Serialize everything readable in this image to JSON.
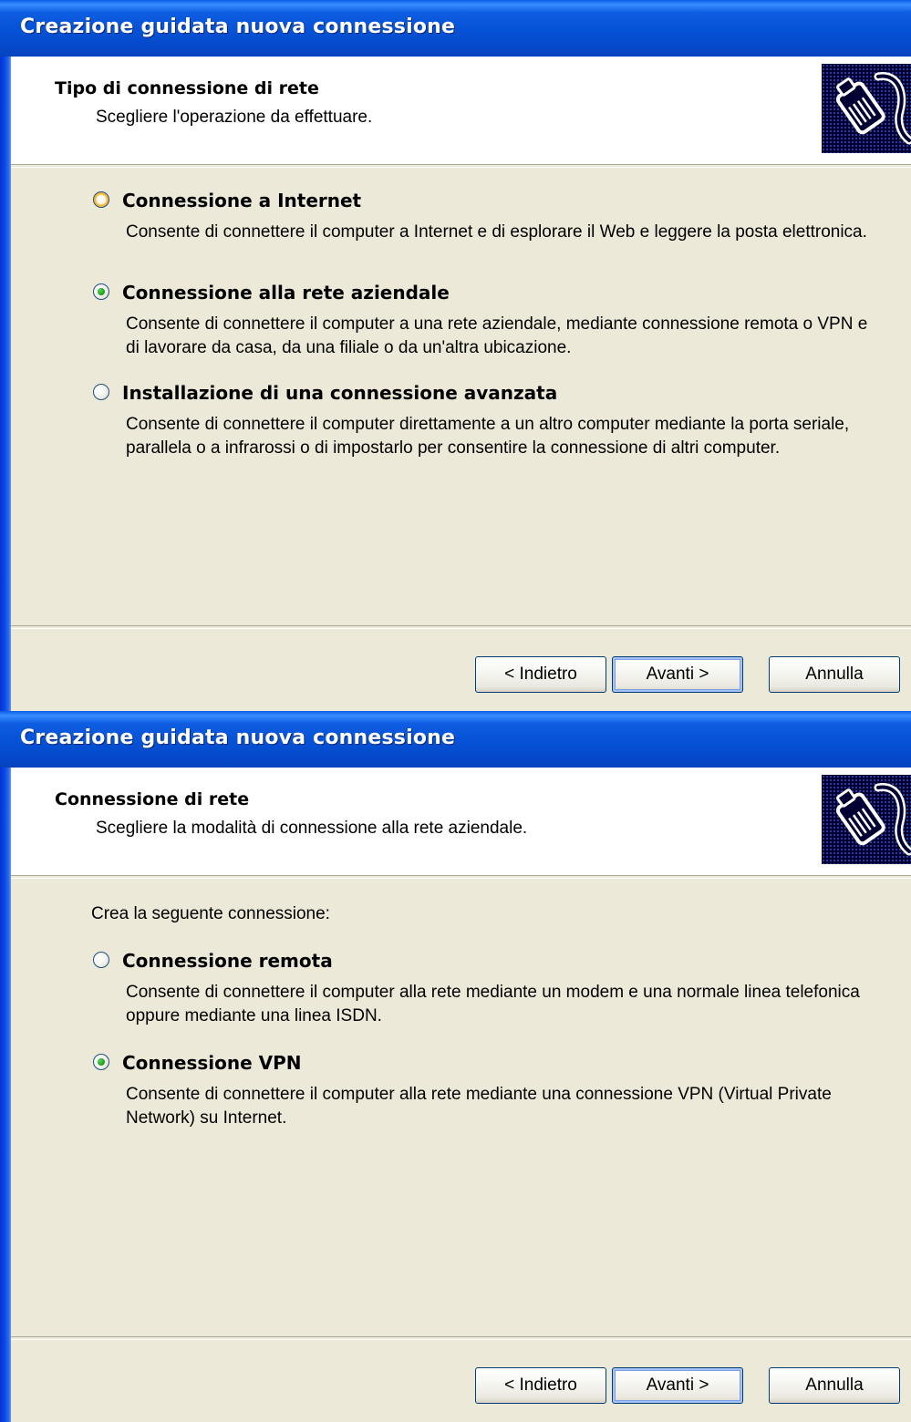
{
  "dialogs": [
    {
      "title": "Creazione guidata nuova connessione",
      "header": {
        "title": "Tipo di connessione di rete",
        "subtitle": "Scegliere l'operazione da effettuare.",
        "icon": "network-cable-icon"
      },
      "intro": "",
      "options": [
        {
          "label": "Connessione a Internet",
          "description": "Consente di connettere il computer a Internet e di esplorare il Web e leggere la posta elettronica.",
          "selected": false,
          "hover": true
        },
        {
          "label": "Connessione alla rete aziendale",
          "description": "Consente di connettere il computer a una rete aziendale, mediante connessione remota o VPN e di lavorare da casa, da una filiale o da un'altra ubicazione.",
          "selected": true,
          "hover": false
        },
        {
          "label": "Installazione di una connessione avanzata",
          "description": "Consente di connettere il computer direttamente a un altro computer mediante la porta seriale, parallela o a infrarossi o di impostarlo per consentire la connessione di altri computer.",
          "selected": false,
          "hover": false
        }
      ],
      "buttons": {
        "back": "< Indietro",
        "next": "Avanti >",
        "cancel": "Annulla"
      }
    },
    {
      "title": "Creazione guidata nuova connessione",
      "header": {
        "title": "Connessione di rete",
        "subtitle": "Scegliere la modalità di connessione alla rete aziendale.",
        "icon": "network-cable-icon"
      },
      "intro": "Crea la seguente connessione:",
      "options": [
        {
          "label": "Connessione remota",
          "description": "Consente di connettere il computer alla rete mediante un modem e una normale linea telefonica oppure mediante una linea ISDN.",
          "selected": false,
          "hover": false
        },
        {
          "label": "Connessione VPN",
          "description": "Consente di connettere il computer alla rete mediante una connessione VPN (Virtual Private Network) su Internet.",
          "selected": true,
          "hover": false
        }
      ],
      "buttons": {
        "back": "< Indietro",
        "next": "Avanti >",
        "cancel": "Annulla"
      }
    }
  ],
  "colors": {
    "title_bar": "#0653D8",
    "dialog_bg": "#ECE9D8",
    "radio_selected": "#21A121",
    "radio_hover": "#F8B636",
    "button_border": "#003C74"
  }
}
